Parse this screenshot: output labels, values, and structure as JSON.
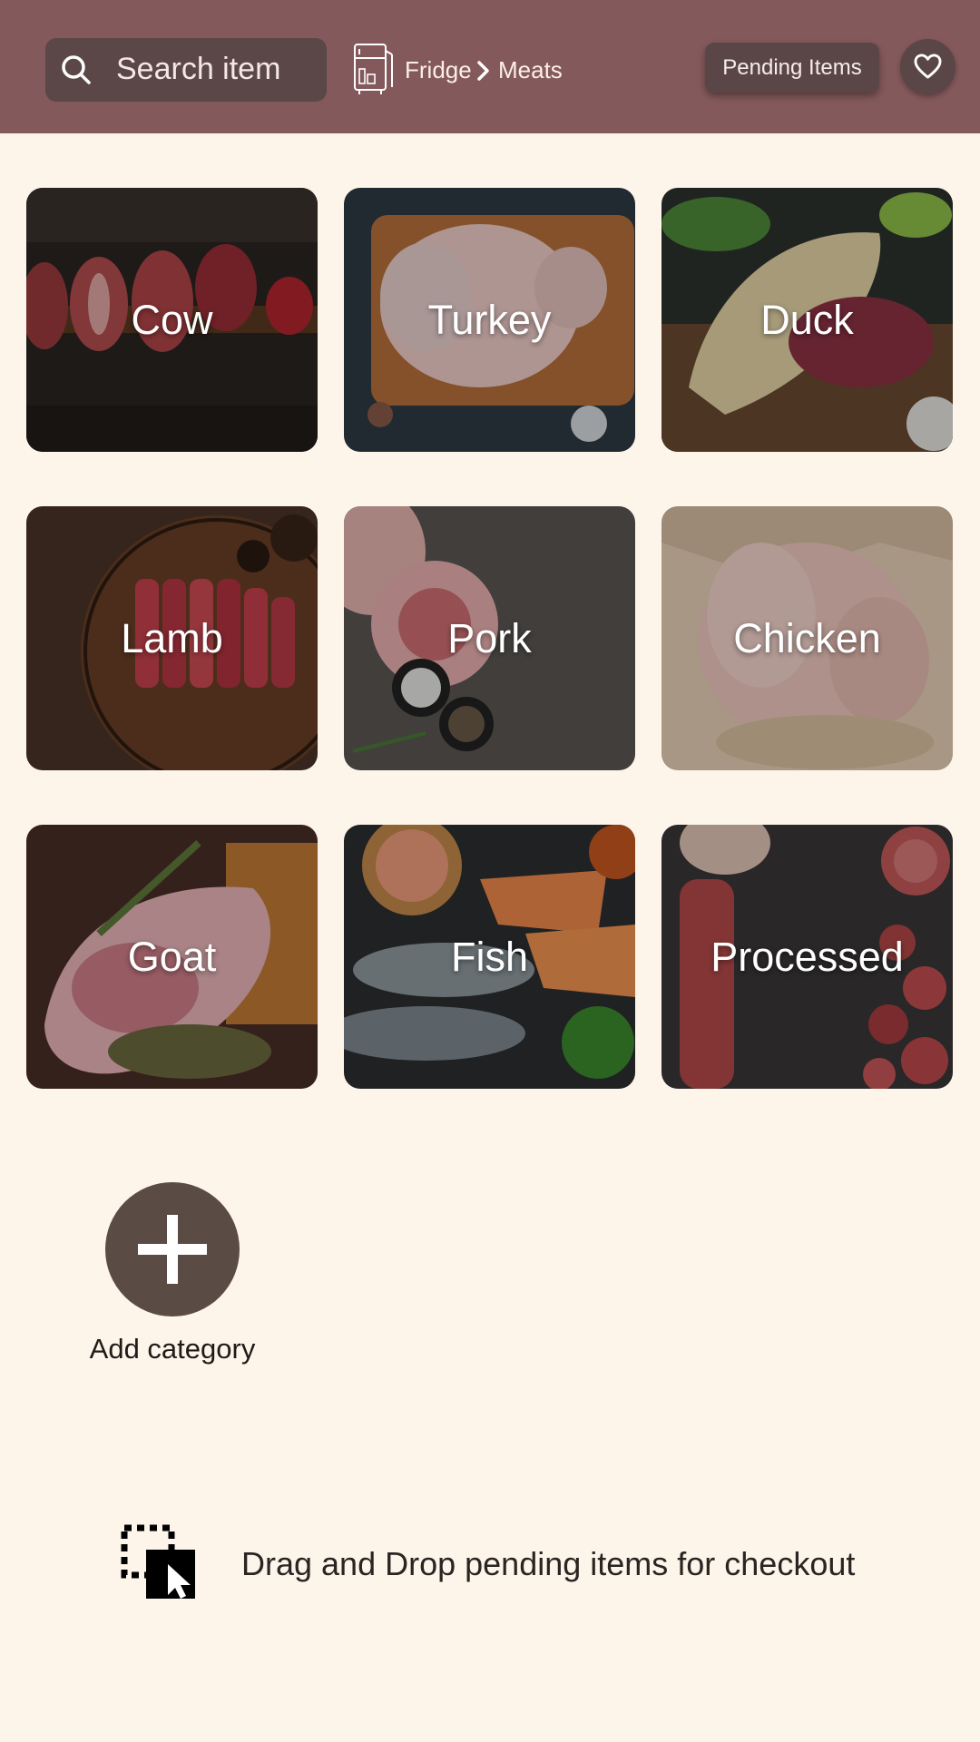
{
  "header": {
    "search_placeholder": "Search item",
    "breadcrumb": [
      "Fridge",
      "Meats"
    ],
    "pending_label": "Pending Items",
    "icons": {
      "search": "search-icon",
      "fridge": "fridge-icon",
      "breadcrumb_separator": "chevron-right-icon",
      "favorite": "heart-icon"
    }
  },
  "categories": [
    {
      "label": "Cow"
    },
    {
      "label": "Turkey"
    },
    {
      "label": "Duck"
    },
    {
      "label": "Lamb"
    },
    {
      "label": "Pork"
    },
    {
      "label": "Chicken"
    },
    {
      "label": "Goat"
    },
    {
      "label": "Fish"
    },
    {
      "label": "Processed"
    }
  ],
  "add_category": {
    "label": "Add category",
    "icon": "plus-icon"
  },
  "drop_zone": {
    "text": "Drag and Drop pending items for checkout",
    "icon": "drag-drop-icon"
  },
  "colors": {
    "header_bg": "#84595b",
    "control_bg": "#5a4646",
    "page_bg": "#fdf5ea",
    "add_button_bg": "#5a4b45"
  }
}
